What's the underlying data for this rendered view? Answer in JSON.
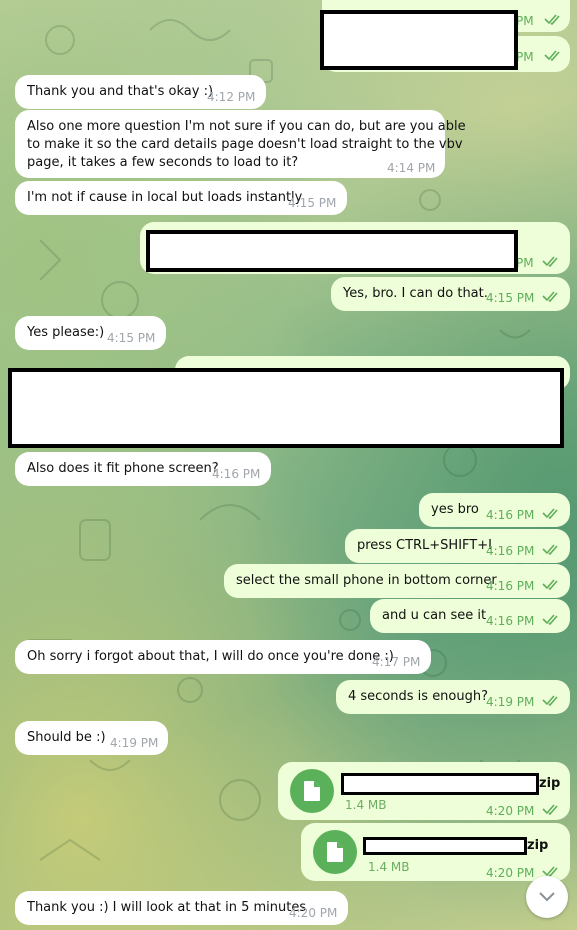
{
  "messages": [
    {
      "text": "Thank you and that's okay :)",
      "time": "4:12 PM"
    },
    {
      "lines": [
        "Also one more question I'm not sure if you can do, but are you able",
        "to make it so the card details page doesn't load straight to the vbv",
        "page, it takes a few seconds to load to it?"
      ],
      "time": "4:14 PM"
    },
    {
      "text": "I'm not if cause in local but loads instantly",
      "time": "4:15 PM"
    },
    {
      "text": "PM",
      "time": ""
    },
    {
      "text": "Yes, bro. I can do that.",
      "time": "4:15 PM"
    },
    {
      "text": "Yes please:)",
      "time": "4:15 PM"
    },
    {
      "text": "Also does it fit phone screen?",
      "time": "4:16 PM"
    },
    {
      "text": "yes bro",
      "time": "4:16 PM"
    },
    {
      "text": "press CTRL+SHIFT+I",
      "time": "4:16 PM"
    },
    {
      "text": "select the small phone in bottom corner",
      "time": "4:16 PM"
    },
    {
      "text": "and u can see it",
      "time": "4:16 PM"
    },
    {
      "text": "Oh sorry i forgot about that, I will do once you're done :)",
      "time": "4:17 PM"
    },
    {
      "text": "4 seconds is enough?",
      "time": "4:19 PM"
    },
    {
      "text": "Should be :)",
      "time": "4:19 PM"
    },
    {
      "text": "Thank you :) I will look at that in 5 minutes",
      "time": "4:20 PM"
    }
  ],
  "top": {
    "pm1": "PM",
    "pm2": "PM"
  },
  "files": [
    {
      "ext": "zip",
      "size": "1.4 MB",
      "time": "4:20 PM"
    },
    {
      "ext": "zip",
      "size": "1.4 MB",
      "time": "4:20 PM"
    }
  ],
  "icons": {
    "file": "file-icon",
    "scroll": "chevron-down-icon",
    "read": "double-check-icon"
  },
  "colors": {
    "incoming": "#ffffff",
    "outgoing": "#eefed8",
    "accent": "#5bb15a",
    "time_out": "#5fae5a"
  }
}
